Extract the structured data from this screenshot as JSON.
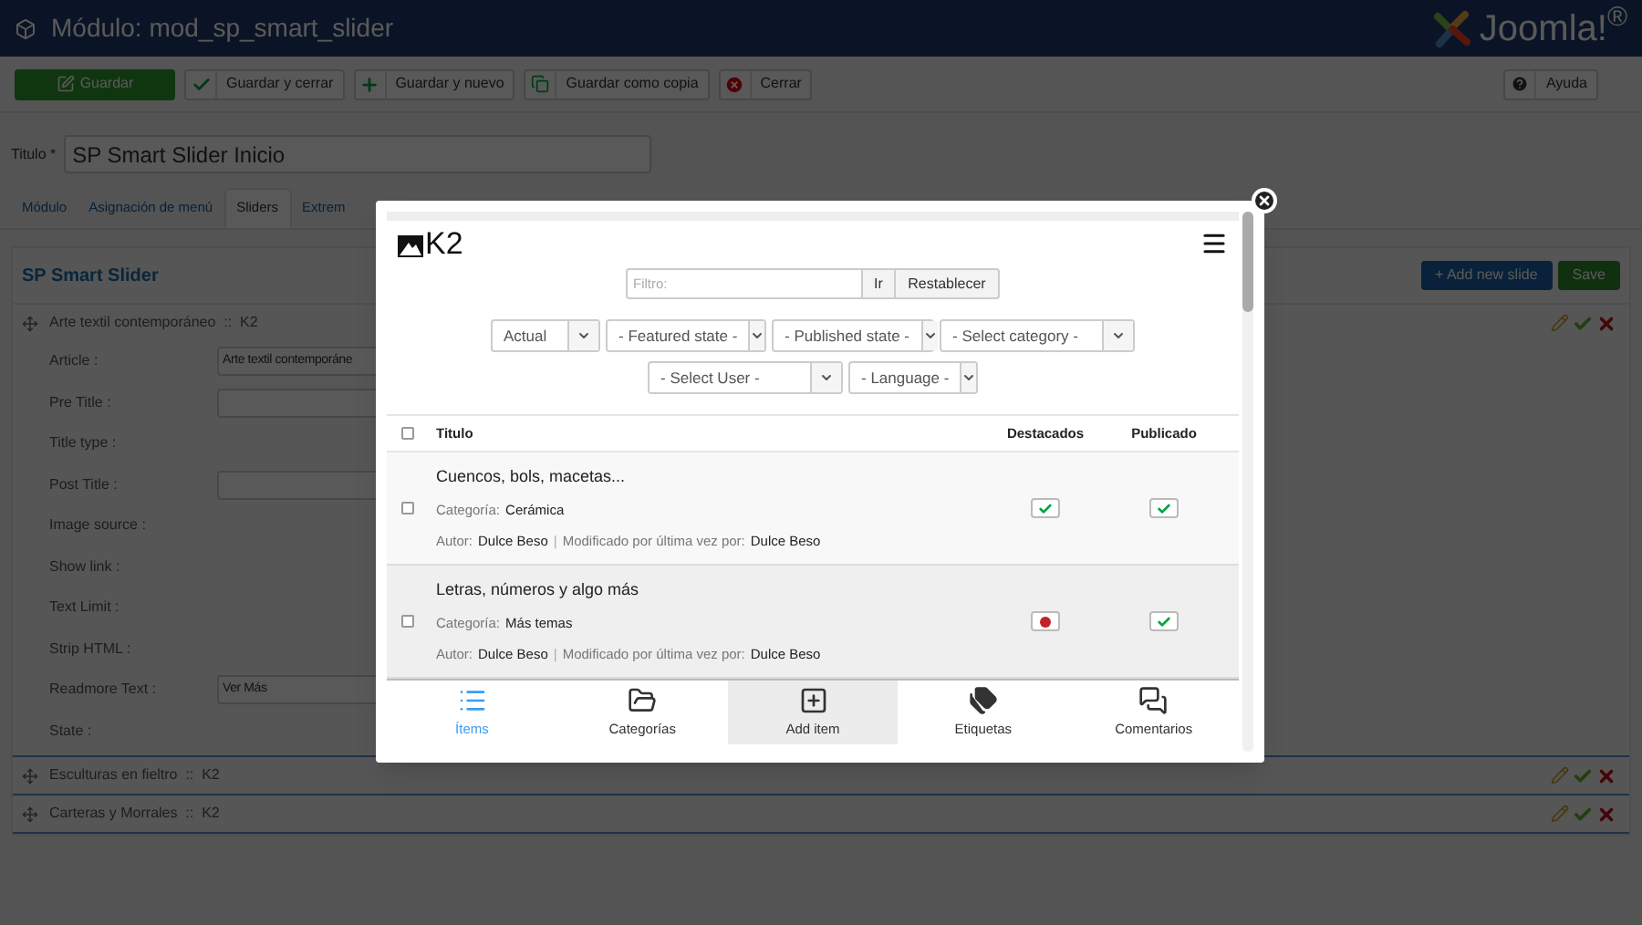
{
  "header": {
    "title": "Módulo: mod_sp_smart_slider",
    "brand": "Joomla!$^{®}$"
  },
  "toolbar": {
    "buttons": [
      {
        "label": "Guardar",
        "kind": "primary"
      },
      {
        "label": "Guardar y cerrar",
        "kind": "check"
      },
      {
        "label": "Guardar y nuevo",
        "kind": "plus"
      },
      {
        "label": "Guardar como copia",
        "kind": "copy"
      },
      {
        "label": "Cerrar",
        "kind": "close"
      }
    ],
    "help": {
      "label": "Ayuda"
    }
  },
  "title_field": {
    "label": "Titulo *",
    "value": "SP Smart Slider Inicio"
  },
  "tabs": [
    {
      "label": "Módulo",
      "selected": false
    },
    {
      "label": "Asignación de menú",
      "selected": false
    },
    {
      "label": "Sliders",
      "selected": true
    },
    {
      "label": "Extrem",
      "selected": false
    }
  ],
  "slider_panel": {
    "title": "SP Smart Slider",
    "add_button": "+ Add new slide",
    "save_button": "Save",
    "slides": [
      {
        "title": "Arte textil contemporáneo  ::  K2",
        "fields": [
          {
            "label": "Article :",
            "kind": "input",
            "value": "Arte textil contemporáne"
          },
          {
            "label": "Pre Title :",
            "kind": "input"
          },
          {
            "label": "Title type :",
            "kind": "none"
          },
          {
            "label": "Post Title :",
            "kind": "input"
          },
          {
            "label": "Image source :",
            "kind": "none"
          },
          {
            "label": "Show link :",
            "kind": "none"
          },
          {
            "label": "Text Limit :",
            "kind": "none"
          },
          {
            "label": "Strip HTML :",
            "kind": "none"
          },
          {
            "label": "Readmore Text :",
            "kind": "input",
            "value": "Ver Más"
          },
          {
            "label": "State :",
            "kind": "none"
          }
        ]
      },
      {
        "title": "Esculturas en fieltro  ::  K2"
      },
      {
        "title": "Carteras y Morrales  ::  K2"
      }
    ]
  },
  "modal": {
    "logo": "K2",
    "filter": {
      "placeholder": "Filtro:",
      "go": "Ir",
      "reset": "Restablecer"
    },
    "selects": [
      [
        "Actual",
        "- Featured state -",
        "- Published state -",
        "- Select category -"
      ],
      [
        "- Select User -",
        "- Language -"
      ]
    ],
    "table": {
      "select_all_checked": false,
      "columns": [
        "Titulo",
        "Destacados",
        "Publicado"
      ],
      "rows": [
        {
          "title": "Cuencos, bols, macetas...",
          "category_label": "Categoría:",
          "category": "Cerámica",
          "author_label": "Autor:",
          "author": "Dulce Beso",
          "separator": "|",
          "modified_label": "Modificado por última vez por:",
          "modified_by": "Dulce Beso",
          "checked": false,
          "featured": true,
          "published": true
        },
        {
          "title": "Letras, números y algo más",
          "category_label": "Categoría:",
          "category": "Más temas",
          "author_label": "Autor:",
          "author": "Dulce Beso",
          "separator": "|",
          "modified_label": "Modificado por última vez por:",
          "modified_by": "Dulce Beso",
          "checked": false,
          "featured": false,
          "published": true
        }
      ]
    },
    "nav": [
      {
        "label": "Ítems",
        "kind": "items",
        "selected": true,
        "highlighted": false
      },
      {
        "label": "Categorías",
        "kind": "categories",
        "selected": false,
        "highlighted": false
      },
      {
        "label": "Add item",
        "kind": "add",
        "selected": false,
        "highlighted": true
      },
      {
        "label": "Etiquetas",
        "kind": "tags",
        "selected": false,
        "highlighted": false
      },
      {
        "label": "Comentarios",
        "kind": "comments",
        "selected": false,
        "highlighted": false
      }
    ]
  }
}
